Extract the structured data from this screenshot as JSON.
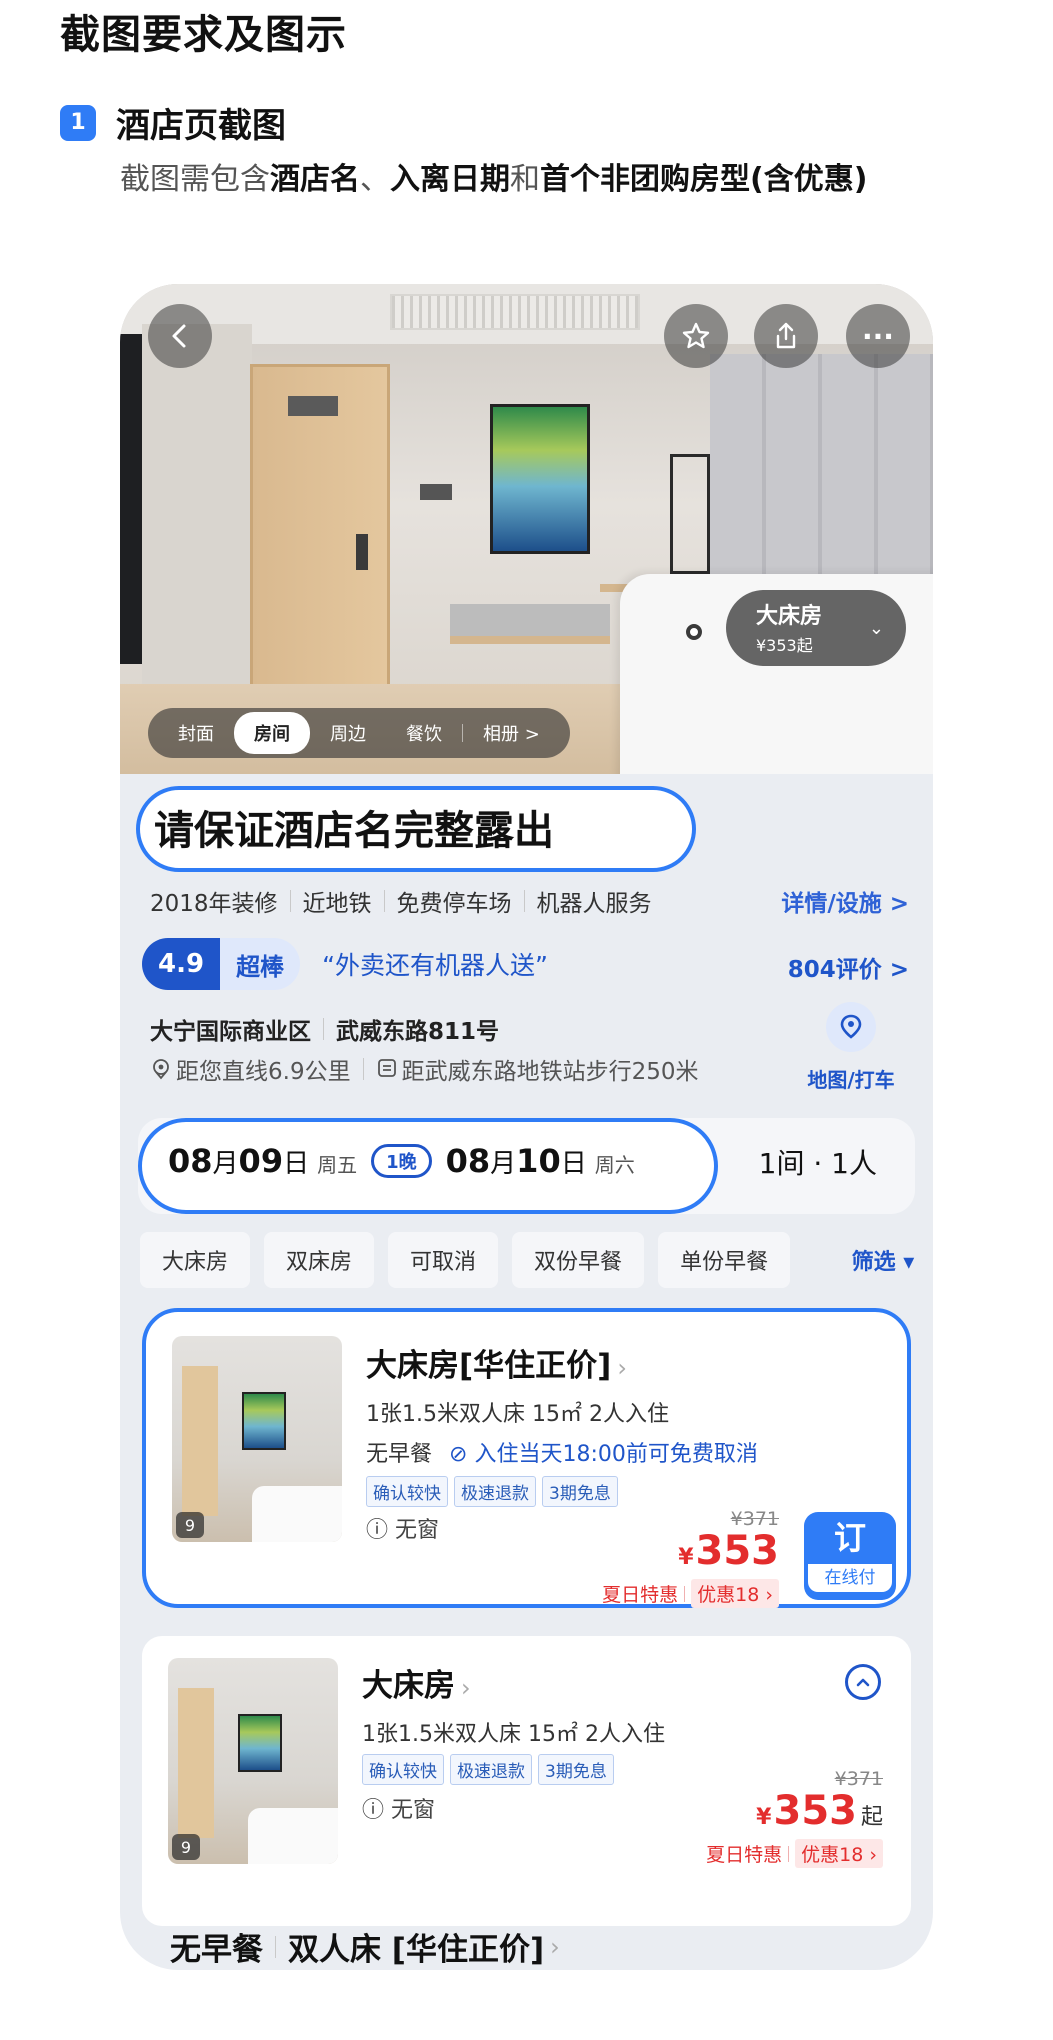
{
  "page": {
    "title": "截图要求及图示",
    "step_number": "1",
    "step_title": "酒店页截图",
    "instruction": {
      "t1": "截图需包含",
      "b1": "酒店名",
      "t2": "、",
      "b2": "入离日期",
      "t3": "和",
      "b3": "首个非团购房型(含优惠)"
    }
  },
  "hero": {
    "tabs": [
      "封面",
      "房间",
      "周边",
      "餐饮",
      "相册 >"
    ],
    "active_tab_index": 1,
    "room_pill": {
      "name": "大床房",
      "price": "¥353起"
    },
    "more_icon_text": "···"
  },
  "hotel": {
    "name": "请保证酒店名完整露出",
    "tags": [
      "2018年装修",
      "近地铁",
      "免费停车场",
      "机器人服务"
    ],
    "details_link": "详情/设施 >",
    "score": "4.9",
    "score_word": "超棒",
    "quote": "“外卖还有机器人送”",
    "reviews_link": "804评价 >",
    "district": "大宁国际商业区",
    "street": "武威东路811号",
    "distance": "距您直线6.9公里",
    "metro": "距武威东路地铁站步行250米",
    "map_label": "地图/打车"
  },
  "dates": {
    "checkin_month": "08",
    "month_unit": "月",
    "checkin_day": "09",
    "day_unit": "日",
    "checkin_week": "周五",
    "nights": "1晚",
    "checkout_month": "08",
    "checkout_day": "10",
    "checkout_week": "周六",
    "guests": "1间 · 1人"
  },
  "filters": [
    "大床房",
    "双床房",
    "可取消",
    "双份早餐",
    "单份早餐"
  ],
  "filter_button": "筛选 ▾",
  "rooms": [
    {
      "title": "大床房[华住正价]",
      "arrow": "›",
      "bed": "1张1.5米双人床  15㎡  2人入住",
      "meal": "无早餐",
      "cancel": "入住当天18:00前可免费取消",
      "badges": [
        "确认较快",
        "极速退款",
        "3期免息"
      ],
      "window": "无窗",
      "old_price": "¥371",
      "yen": "¥",
      "price": "353",
      "promo": "夏日特惠",
      "coupon": "优惠18 ›",
      "photo_count": "9",
      "book_top": "订",
      "book_bottom": "在线付"
    },
    {
      "title": "大床房",
      "arrow": "›",
      "bed": "1张1.5米双人床  15㎡  2人入住",
      "badges": [
        "确认较快",
        "极速退款",
        "3期免息"
      ],
      "window": "无窗",
      "old_price": "¥371",
      "yen": "¥",
      "price": "353",
      "qi": "起",
      "promo": "夏日特惠",
      "coupon": "优惠18 ›",
      "photo_count": "9"
    }
  ],
  "next_room": {
    "meal": "无早餐",
    "title": "双人床 [华住正价]",
    "arrow": "›"
  },
  "colors": {
    "accent": "#2f7cf6",
    "brand_blue": "#1f55c9",
    "price_red": "#e32d2d"
  }
}
